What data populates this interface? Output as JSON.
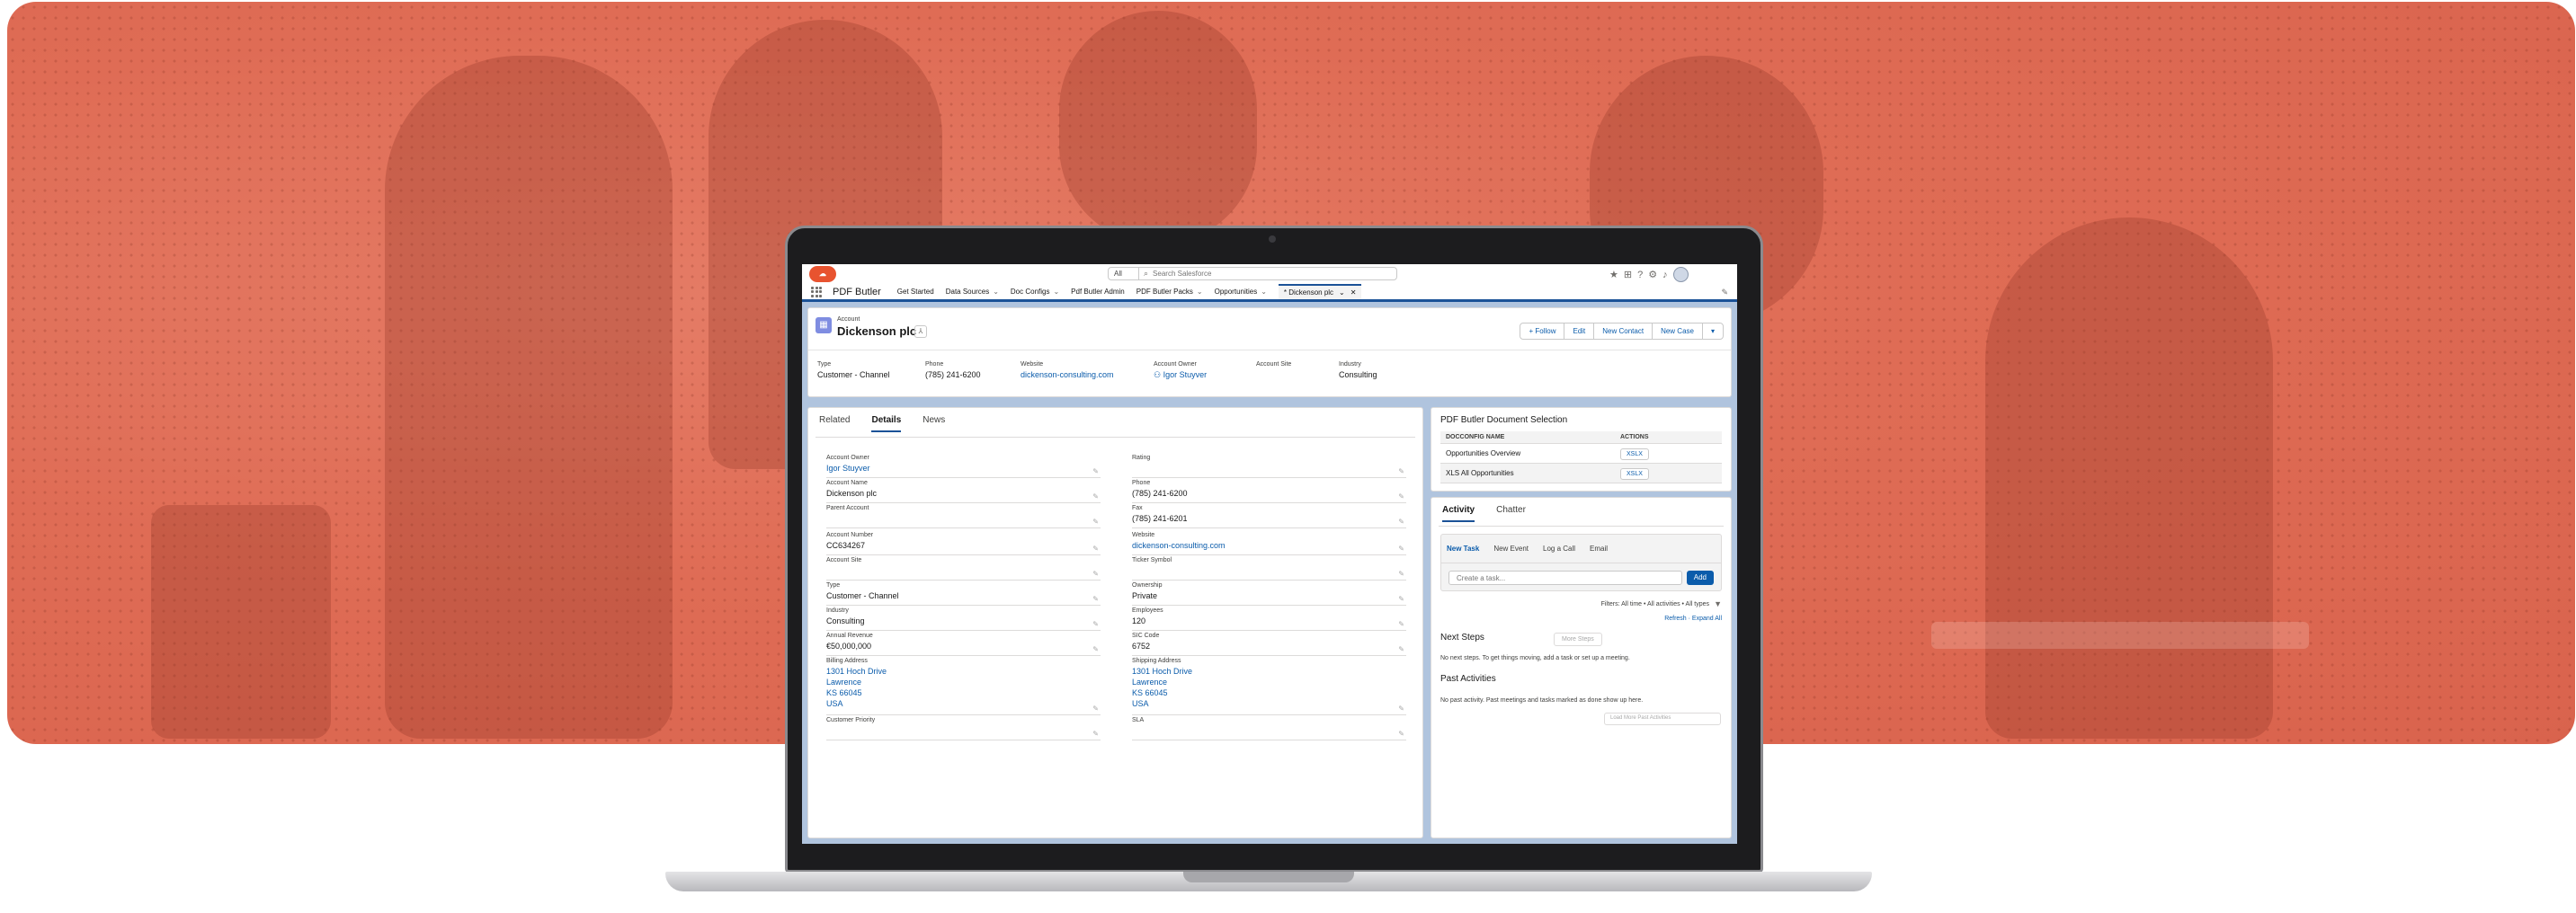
{
  "topbar": {
    "logo_text": "Salesforce",
    "search_scope": "All",
    "search_placeholder": "Search Salesforce",
    "utility_icons": [
      "favorites-icon",
      "add-icon",
      "help-icon",
      "setup-gear-icon",
      "notifications-bell-icon"
    ]
  },
  "nav": {
    "app_name": "PDF Butler",
    "items": [
      {
        "label": "Get Started",
        "dropdown": false
      },
      {
        "label": "Data Sources",
        "dropdown": true
      },
      {
        "label": "Doc Configs",
        "dropdown": true
      },
      {
        "label": "Pdf Butler Admin",
        "dropdown": false
      },
      {
        "label": "PDF Butler Packs",
        "dropdown": true
      },
      {
        "label": "Opportunities",
        "dropdown": true
      }
    ],
    "open_tab": "* Dickenson plc"
  },
  "record": {
    "object_label": "Account",
    "name": "Dickenson plc",
    "actions": [
      "+ Follow",
      "Edit",
      "New Contact",
      "New Case",
      "▾"
    ],
    "highlights": [
      {
        "label": "Type",
        "value": "Customer - Channel",
        "link": false
      },
      {
        "label": "Phone",
        "value": "(785) 241-6200",
        "link": false
      },
      {
        "label": "Website",
        "value": "dickenson-consulting.com",
        "link": true
      },
      {
        "label": "Account Owner",
        "value": "Igor Stuyver",
        "link": true
      },
      {
        "label": "Account Site",
        "value": "",
        "link": false
      },
      {
        "label": "Industry",
        "value": "Consulting",
        "link": false
      }
    ]
  },
  "details": {
    "tabs": [
      "Related",
      "Details",
      "News"
    ],
    "active_tab": "Details",
    "left_fields": [
      {
        "label": "Account Owner",
        "value": "Igor Stuyver",
        "link": true
      },
      {
        "label": "Account Name",
        "value": "Dickenson plc",
        "link": false
      },
      {
        "label": "Parent Account",
        "value": "",
        "link": false
      },
      {
        "label": "Account Number",
        "value": "CC634267",
        "link": false
      },
      {
        "label": "Account Site",
        "value": "",
        "link": false
      },
      {
        "label": "Type",
        "value": "Customer - Channel",
        "link": false
      },
      {
        "label": "Industry",
        "value": "Consulting",
        "link": false
      },
      {
        "label": "Annual Revenue",
        "value": "€50,000,000",
        "link": false
      },
      {
        "label": "Billing Address",
        "value": "1301 Hoch Drive\nLawrence\nKS 66045\nUSA",
        "link": true
      },
      {
        "label": "Customer Priority",
        "value": "",
        "link": false
      }
    ],
    "right_fields": [
      {
        "label": "Rating",
        "value": "",
        "link": false
      },
      {
        "label": "Phone",
        "value": "(785) 241-6200",
        "link": false
      },
      {
        "label": "Fax",
        "value": "(785) 241-6201",
        "link": false
      },
      {
        "label": "Website",
        "value": "dickenson-consulting.com",
        "link": true
      },
      {
        "label": "Ticker Symbol",
        "value": "",
        "link": false
      },
      {
        "label": "Ownership",
        "value": "Private",
        "link": false
      },
      {
        "label": "Employees",
        "value": "120",
        "link": false
      },
      {
        "label": "SIC Code",
        "value": "6752",
        "link": false
      },
      {
        "label": "Shipping Address",
        "value": "1301 Hoch Drive\nLawrence\nKS 66045\nUSA",
        "link": true
      },
      {
        "label": "SLA",
        "value": "",
        "link": false
      }
    ]
  },
  "doc_selection": {
    "title": "PDF Butler Document Selection",
    "columns": [
      "DOCCONFIG NAME",
      "ACTIONS"
    ],
    "rows": [
      {
        "name": "Opportunities Overview",
        "action": "XSLX"
      },
      {
        "name": "XLS All Opportunities",
        "action": "XSLX"
      }
    ]
  },
  "activity": {
    "tabs": [
      "Activity",
      "Chatter"
    ],
    "active_tab": "Activity",
    "composer_tabs": [
      "New Task",
      "New Event",
      "Log a Call",
      "Email"
    ],
    "active_composer_tab": "New Task",
    "task_placeholder": "Create a task...",
    "add_label": "Add",
    "filters_text": "Filters: All time • All activities • All types",
    "refresh_text": "Refresh · Expand All",
    "next_steps_title": "Next Steps",
    "more_steps_label": "More Steps",
    "next_steps_empty": "No next steps. To get things moving, add a task or set up a meeting.",
    "past_title": "Past Activities",
    "past_empty": "No past activity. Past meetings and tasks marked as done show up here.",
    "load_more": "Load More Past Activities"
  },
  "colors": {
    "hero": "#df6c55",
    "brand": "#1b5297",
    "link": "#0b5cab",
    "page_bg": "#b0c4de"
  }
}
